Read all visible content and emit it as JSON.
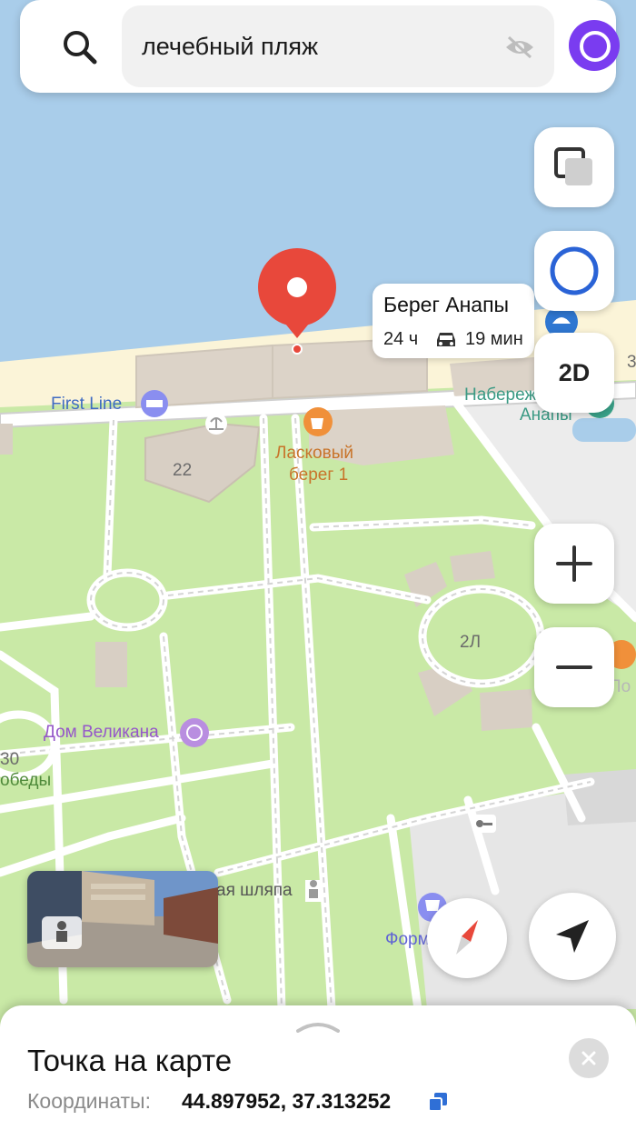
{
  "search": {
    "query": "лечебный пляж"
  },
  "map": {
    "labels": {
      "first_line": "First Line",
      "laskovy_1": "Ласковый",
      "laskovy_2": "берег 1",
      "naberezhnaya_1": "Набережная",
      "naberezhnaya_2": "Анапы",
      "building_22": "22",
      "building_2l": "2Л",
      "dom_velikana": "Дом Великана",
      "pobedy_num": "30",
      "pobedy": "обеды",
      "shlyapa": "ая шляпа",
      "formula": "Формул",
      "il_po": "Иль По",
      "edge_3": "3"
    }
  },
  "place_card": {
    "name": "Берег Анапы",
    "hours": "24 ч",
    "drive_time": "19 мин"
  },
  "controls": {
    "mode_label": "2D"
  },
  "sheet": {
    "title": "Точка на карте",
    "coord_label": "Координаты:",
    "coord_value": "44.897952, 37.313252"
  },
  "colors": {
    "sea": "#a9cdea",
    "park": "#c9e9a6",
    "beach": "#fbf4d8",
    "pin": "#e8483b",
    "alice": "#7a3cf0"
  }
}
